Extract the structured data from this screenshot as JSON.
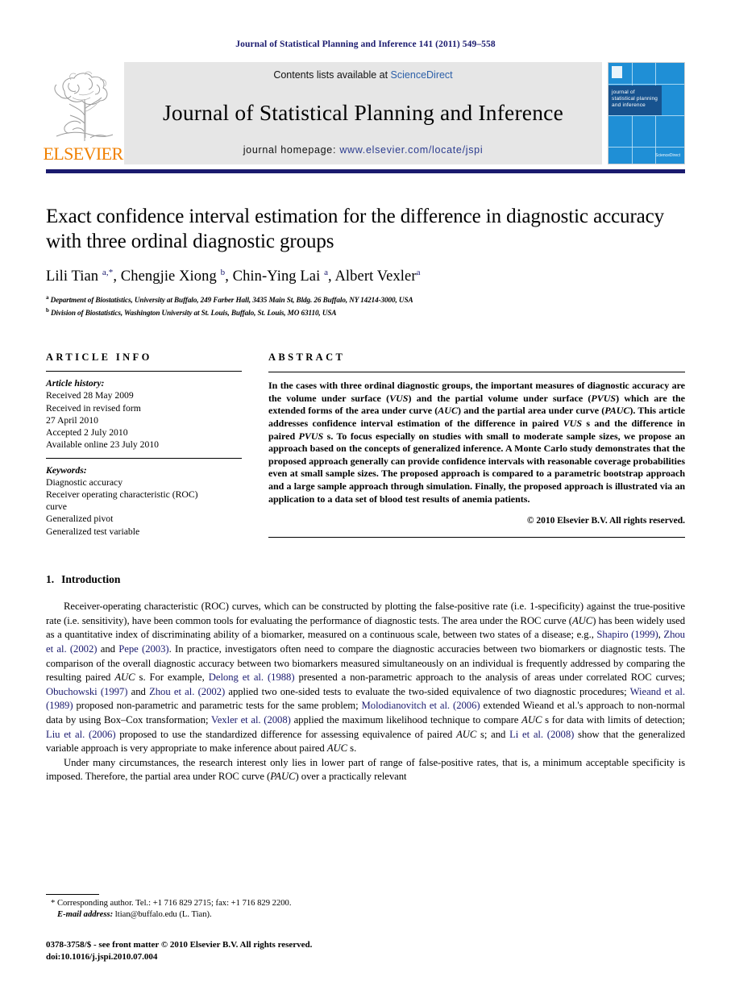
{
  "running_head": "Journal of Statistical Planning and Inference 141 (2011) 549–558",
  "masthead": {
    "publisher_name": "ELSEVIER",
    "contents_prefix": "Contents lists available at ",
    "contents_link": "ScienceDirect",
    "journal_title": "Journal of Statistical Planning and Inference",
    "homepage_prefix": "journal homepage: ",
    "homepage_url": "www.elsevier.com/locate/jspi",
    "cover_text": "journal of\nstatistical planning\nand inference",
    "cover_sd": "ScienceDirect",
    "rule_color": "#1a1a6e"
  },
  "article": {
    "title": "Exact confidence interval estimation for the difference in diagnostic accuracy with three ordinal diagnostic groups",
    "authors_html": "Lili Tian <sup>a,*</sup>, Chengjie Xiong <sup>b</sup>, Chin-Ying Lai <sup>a</sup>, Albert Vexler<sup>a</sup>",
    "affiliations": [
      {
        "marker": "a",
        "text": "Department of Biostatistics, University at Buffalo, 249 Farber Hall, 3435 Main St, Bldg. 26 Buffalo, NY 14214-3000, USA"
      },
      {
        "marker": "b",
        "text": "Division of Biostatistics, Washington University at St. Louis, Buffalo, St. Louis, MO 63110, USA"
      }
    ]
  },
  "article_info": {
    "heading": "ARTICLE INFO",
    "history_label": "Article history:",
    "history": [
      "Received 28 May 2009",
      "Received in revised form",
      "27 April 2010",
      "Accepted 2 July 2010",
      "Available online 23 July 2010"
    ],
    "keywords_label": "Keywords:",
    "keywords": [
      "Diagnostic accuracy",
      "Receiver operating characteristic (ROC)",
      "curve",
      "Generalized pivot",
      "Generalized test variable"
    ]
  },
  "abstract": {
    "heading": "ABSTRACT",
    "text_html": "In the cases with three ordinal diagnostic groups, the important measures of diagnostic accuracy are the volume under surface (<i>VUS</i>) and the partial volume under surface (<i>PVUS</i>) which are the extended forms of the area under curve (<i>AUC</i>) and the partial area under curve (<i>PAUC</i>). This article addresses confidence interval estimation of the difference in paired <i>VUS</i> s and the difference in paired <i>PVUS</i> s. To focus especially on studies with small to moderate sample sizes, we propose an approach based on the concepts of generalized inference. A Monte Carlo study demonstrates that the proposed approach generally can provide confidence intervals with reasonable coverage probabilities even at small sample sizes. The proposed approach is compared to a parametric bootstrap approach and a large sample approach through simulation. Finally, the proposed approach is illustrated via an application to a data set of blood test results of anemia patients.",
    "copyright": "© 2010 Elsevier B.V. All rights reserved."
  },
  "body": {
    "section_number": "1.",
    "section_title": "Introduction",
    "paragraph1_html": "Receiver-operating characteristic (ROC) curves, which can be constructed by plotting the false-positive rate (i.e. 1-specificity) against the true-positive rate (i.e. sensitivity), have been common tools for evaluating the performance of diagnostic tests. The area under the ROC curve (<i>AUC</i>) has been widely used as a quantitative index of discriminating ability of a biomarker, measured on a continuous scale, between two states of a disease; e.g., <a class=\"ref\" href=\"#\">Shapiro (1999)</a>, <a class=\"ref\" href=\"#\">Zhou et al. (2002)</a> and <a class=\"ref\" href=\"#\">Pepe (2003)</a>. In practice, investigators often need to compare the diagnostic accuracies between two biomarkers or diagnostic tests. The comparison of the overall diagnostic accuracy between two biomarkers measured simultaneously on an individual is frequently addressed by comparing the resulting paired <i>AUC</i> s. For example, <a class=\"ref\" href=\"#\">Delong et al. (1988)</a> presented a non-parametric approach to the analysis of areas under correlated ROC curves; <a class=\"ref\" href=\"#\">Obuchowski (1997)</a> and <a class=\"ref\" href=\"#\">Zhou et al. (2002)</a> applied two one-sided tests to evaluate the two-sided equivalence of two diagnostic procedures; <a class=\"ref\" href=\"#\">Wieand et al. (1989)</a> proposed non-parametric and parametric tests for the same problem; <a class=\"ref\" href=\"#\">Molodianovitch et al. (2006)</a> extended Wieand et al.'s approach to non-normal data by using Box–Cox transformation; <a class=\"ref\" href=\"#\">Vexler et al. (2008)</a> applied the maximum likelihood technique to compare <i>AUC</i> s for data with limits of detection; <a class=\"ref\" href=\"#\">Liu et al. (2006)</a> proposed to use the standardized difference for assessing equivalence of paired <i>AUC</i> s; and <a class=\"ref\" href=\"#\">Li et al. (2008)</a> show that the generalized variable approach is very appropriate to make inference about paired <i>AUC</i> s.",
    "paragraph2_html": "Under many circumstances, the research interest only lies in lower part of range of false-positive rates, that is, a minimum acceptable specificity is imposed. Therefore, the partial area under ROC curve (<i>PAUC</i>) over a practically relevant"
  },
  "footnote": {
    "corresponding_html": "* Corresponding author. Tel.: +1 716 829 2715; fax: +1 716 829 2200.",
    "email_html": "<span class=\"it\">E-mail address:</span> ltian@buffalo.edu (L. Tian)."
  },
  "footer": {
    "issn_line": "0378-3758/$ - see front matter © 2010 Elsevier B.V. All rights reserved.",
    "doi_line": "doi:10.1016/j.jspi.2010.07.004"
  }
}
